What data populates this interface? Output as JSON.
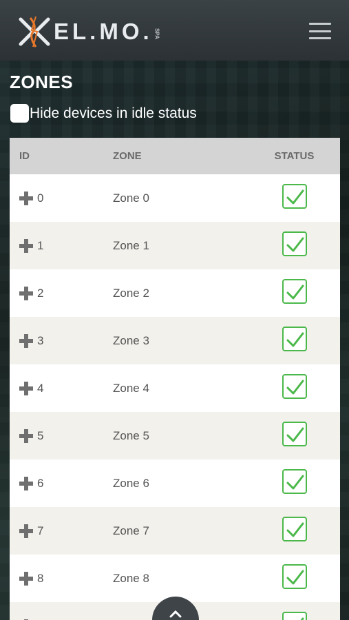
{
  "header": {
    "logo_text": "EL.MO.",
    "logo_suffix": "SPA",
    "menu_icon": "hamburger-menu-icon"
  },
  "page": {
    "title": "ZONES",
    "filter_label": "Hide devices in idle status",
    "filter_checked": false
  },
  "table": {
    "columns": [
      "ID",
      "ZONE",
      "STATUS"
    ],
    "rows": [
      {
        "id": "0",
        "zone": "Zone 0",
        "status": "ok"
      },
      {
        "id": "1",
        "zone": "Zone 1",
        "status": "ok"
      },
      {
        "id": "2",
        "zone": "Zone 2",
        "status": "ok"
      },
      {
        "id": "3",
        "zone": "Zone 3",
        "status": "ok"
      },
      {
        "id": "4",
        "zone": "Zone 4",
        "status": "ok"
      },
      {
        "id": "5",
        "zone": "Zone 5",
        "status": "ok"
      },
      {
        "id": "6",
        "zone": "Zone 6",
        "status": "ok"
      },
      {
        "id": "7",
        "zone": "Zone 7",
        "status": "ok"
      },
      {
        "id": "8",
        "zone": "Zone 8",
        "status": "ok"
      },
      {
        "id": "",
        "zone": "",
        "status": "ok"
      }
    ]
  },
  "colors": {
    "accent_orange": "#e8782a",
    "status_green": "#4bb84a",
    "header_bg": "#31383c"
  },
  "scroll_top_icon": "chevron-up-icon"
}
